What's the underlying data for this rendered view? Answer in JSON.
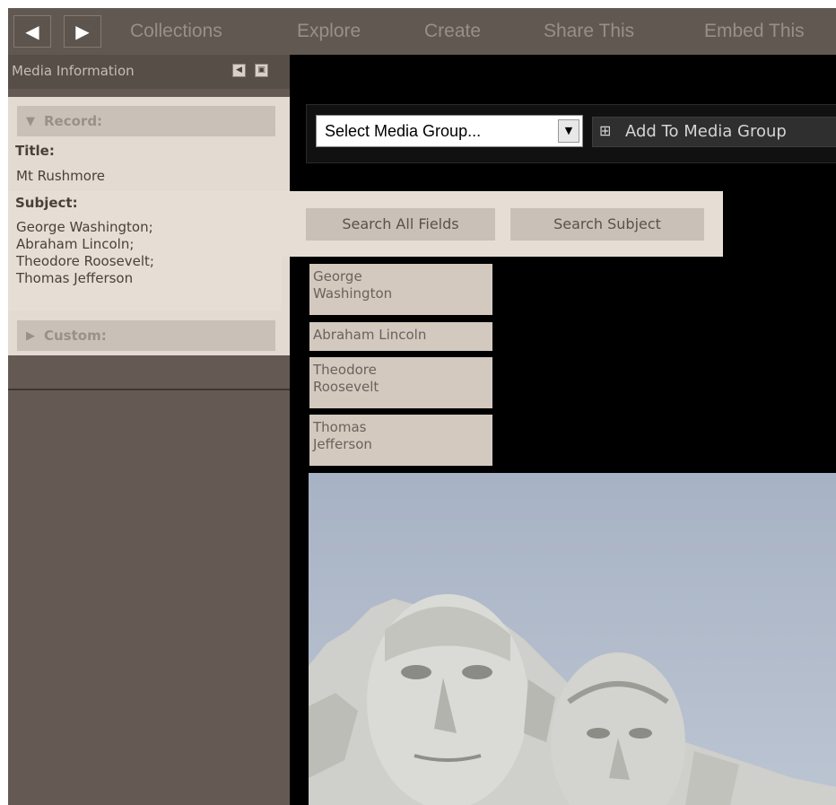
{
  "nav": {
    "back_icon": "triangle-left-icon",
    "forward_icon": "triangle-right-icon",
    "items": [
      "Collections",
      "Explore",
      "Create",
      "Share This",
      "Embed This"
    ]
  },
  "sidebar": {
    "title": "Media Information",
    "record": {
      "section_label": "Record:",
      "title_label": "Title:",
      "title_value": "Mt Rushmore",
      "subject_label": "Subject:",
      "subject_lines": [
        "George Washington;",
        "Abraham Lincoln;",
        "Theodore Roosevelt;",
        "Thomas Jefferson"
      ]
    },
    "custom_label": "Custom:"
  },
  "toolbar": {
    "select_value": "Select Media Group...",
    "add_label": "Add To Media Group"
  },
  "search": {
    "all_fields": "Search All Fields",
    "subject": "Search Subject"
  },
  "tags": [
    [
      "George",
      "Washington"
    ],
    [
      "Abraham Lincoln"
    ],
    [
      "Theodore",
      "Roosevelt"
    ],
    [
      "Thomas",
      "Jefferson"
    ]
  ],
  "colors": {
    "nav_bg": "#615851",
    "sidebar_bg": "#655a53",
    "panel_bg": "#e3dbd2",
    "main_bg": "#000000",
    "tag_bg": "#d3c9bf"
  }
}
